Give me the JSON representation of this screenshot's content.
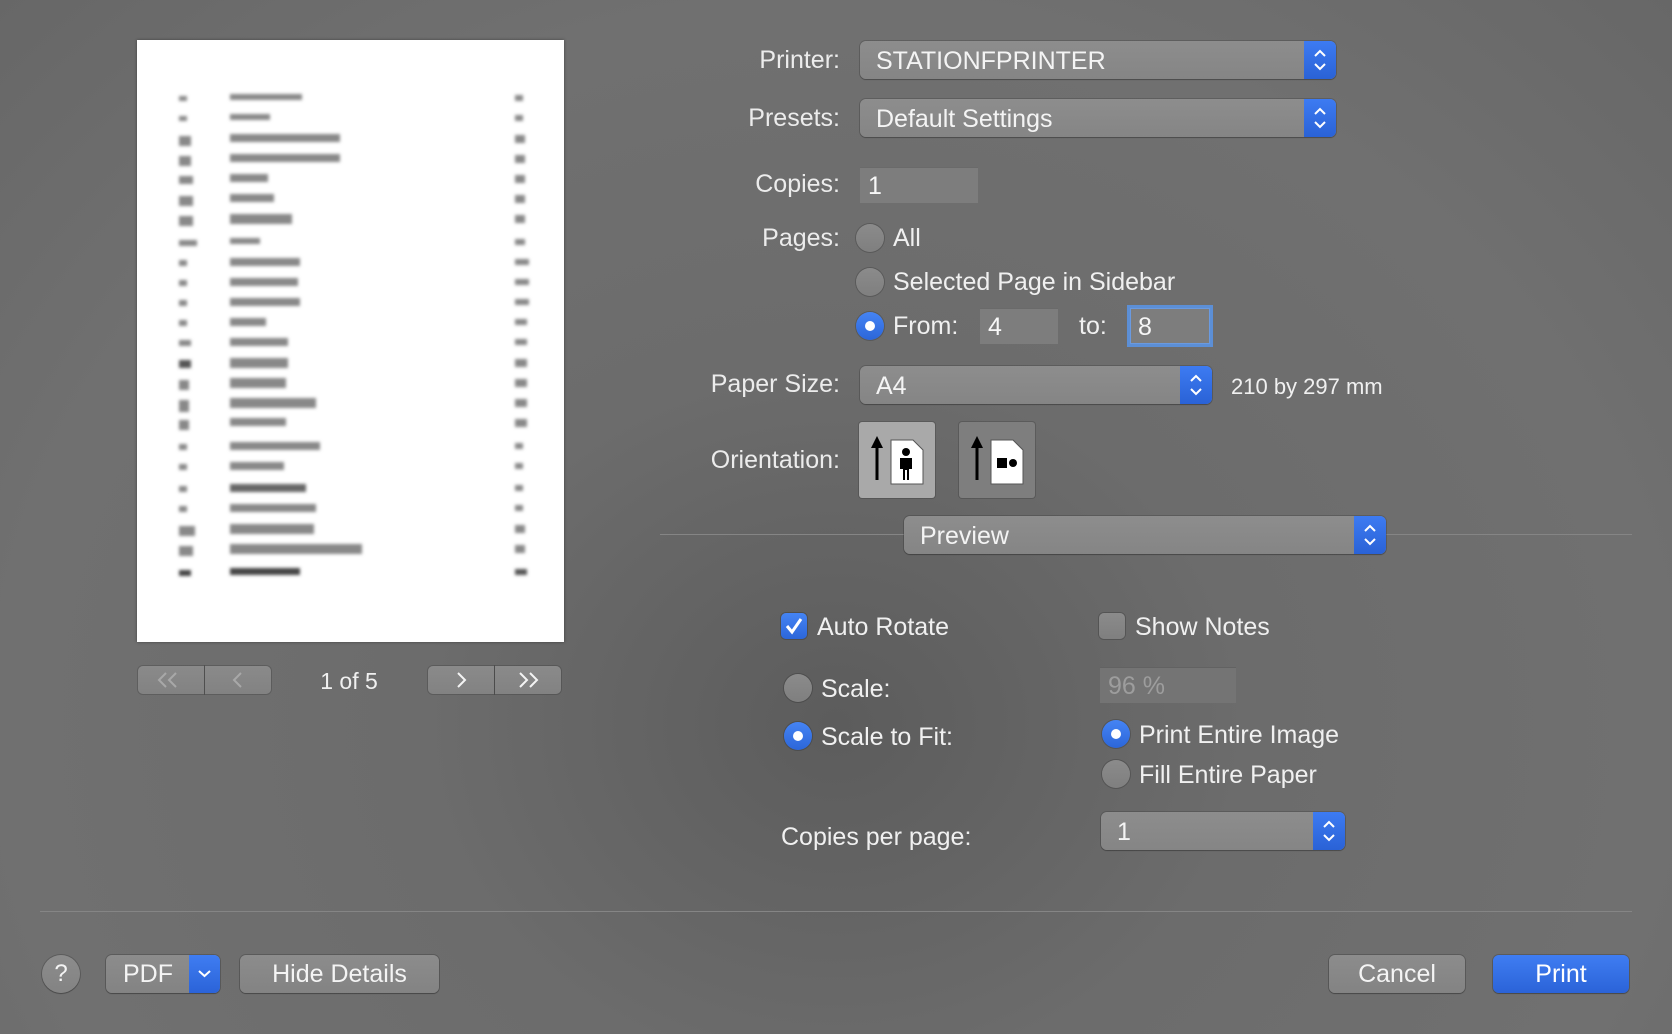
{
  "printer": {
    "label": "Printer:",
    "value": "STATIONFPRINTER"
  },
  "presets": {
    "label": "Presets:",
    "value": "Default Settings"
  },
  "copies": {
    "label": "Copies:",
    "value": "1"
  },
  "pages": {
    "label": "Pages:",
    "all_label": "All",
    "selected_label": "Selected Page in Sidebar",
    "from_label": "From:",
    "from_value": "4",
    "to_label": "to:",
    "to_value": "8"
  },
  "paper_size": {
    "label": "Paper Size:",
    "value": "A4",
    "dimensions": "210 by 297 mm"
  },
  "orientation": {
    "label": "Orientation:",
    "selected": "portrait"
  },
  "section_popup": {
    "value": "Preview"
  },
  "preview_options": {
    "auto_rotate_label": "Auto Rotate",
    "auto_rotate_checked": true,
    "show_notes_label": "Show Notes",
    "show_notes_checked": false,
    "scale_label": "Scale:",
    "scale_value": "96 %",
    "scale_to_fit_label": "Scale to Fit:",
    "print_entire_image_label": "Print Entire Image",
    "fill_entire_paper_label": "Fill Entire Paper",
    "copies_per_page_label": "Copies per page:",
    "copies_per_page_value": "1"
  },
  "page_nav": {
    "page_indicator": "1 of 5"
  },
  "footer": {
    "help_label": "?",
    "pdf_label": "PDF",
    "hide_details_label": "Hide Details",
    "cancel_label": "Cancel",
    "print_label": "Print"
  },
  "colors": {
    "accent": "#2b63d8",
    "background": "#6c6c6c"
  }
}
